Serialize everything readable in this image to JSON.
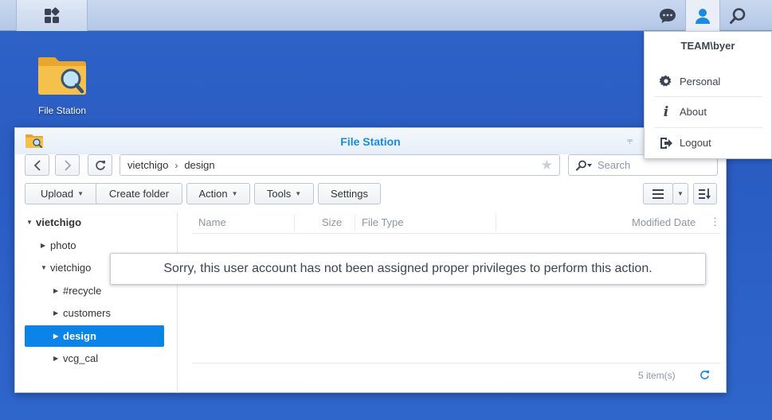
{
  "taskbar": {
    "main_menu_icon": "grid-icon",
    "notifications_icon": "chat-bubble-icon",
    "user_icon": "user-icon",
    "search_icon": "search-icon"
  },
  "desktop": {
    "icons": [
      {
        "label": "File Station",
        "icon": "folder-search-icon"
      }
    ]
  },
  "user_menu": {
    "username": "TEAM\\byer",
    "items": [
      {
        "label": "Personal",
        "icon": "gear-icon"
      },
      {
        "label": "About",
        "icon": "info-icon"
      },
      {
        "label": "Logout",
        "icon": "logout-icon"
      }
    ]
  },
  "window": {
    "title": "File Station",
    "path": [
      "vietchigo",
      "design"
    ],
    "search": {
      "placeholder": "Search",
      "value": ""
    },
    "toolbar": {
      "upload": "Upload",
      "create_folder": "Create folder",
      "action": "Action",
      "tools": "Tools",
      "settings": "Settings"
    },
    "tree": {
      "root": "vietchigo",
      "items": [
        {
          "label": "photo",
          "depth": 1,
          "expanded": false
        },
        {
          "label": "vietchigo",
          "depth": 1,
          "expanded": true
        },
        {
          "label": "#recycle",
          "depth": 2,
          "expanded": false
        },
        {
          "label": "customers",
          "depth": 2,
          "expanded": false
        },
        {
          "label": "design",
          "depth": 2,
          "expanded": false,
          "selected": true
        },
        {
          "label": "vcg_cal",
          "depth": 2,
          "expanded": false
        }
      ]
    },
    "columns": [
      "Name",
      "Size",
      "File Type",
      "Modified Date"
    ],
    "status": {
      "item_count": "5 item(s)"
    }
  },
  "toast": {
    "message": "Sorry, this user account has not been assigned proper privileges to perform this action."
  },
  "colors": {
    "desktop": "#2f63c8",
    "accent": "#0a84e6",
    "title": "#1a8be0",
    "taskbar": "#c3d3ec"
  }
}
